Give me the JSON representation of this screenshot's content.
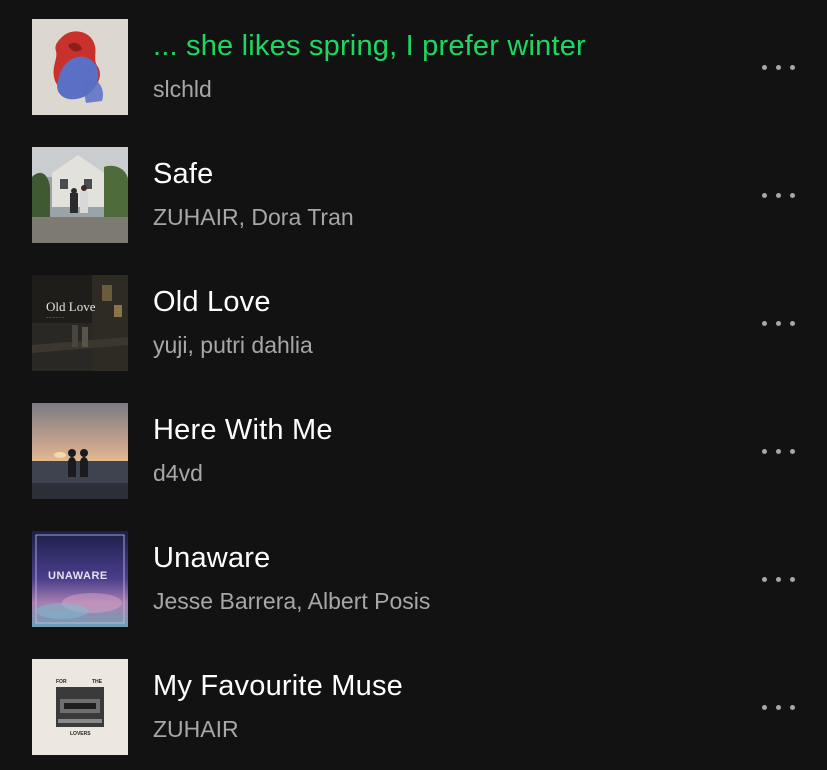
{
  "tracks": [
    {
      "title": "... she likes spring, I prefer winter",
      "artist": "slchld",
      "playing": true,
      "art": "red-blue-hugging-figures-art"
    },
    {
      "title": "Safe",
      "artist": "ZUHAIR, Dora Tran",
      "playing": false,
      "art": "house-couple-photo-art"
    },
    {
      "title": "Old Love",
      "artist": "yuji, putri dahlia",
      "playing": false,
      "art": "night-street-photo-art",
      "art_text": "Old Love"
    },
    {
      "title": "Here With Me",
      "artist": "d4vd",
      "playing": false,
      "art": "sunset-beach-couple-art"
    },
    {
      "title": "Unaware",
      "artist": "Jesse Barrera, Albert Posis",
      "playing": false,
      "art": "purple-sky-art",
      "art_text": "UNAWARE"
    },
    {
      "title": "My Favourite Muse",
      "artist": "ZUHAIR",
      "playing": false,
      "art": "for-the-lovers-art",
      "art_text_top_left": "FOR",
      "art_text_top_right": "THE",
      "art_text_bottom": "LOVERS"
    }
  ],
  "colors": {
    "background": "#121212",
    "playing": "#1ed760",
    "title": "#ffffff",
    "secondary": "#a7a7a7"
  },
  "more_icon": "more-horizontal-icon"
}
